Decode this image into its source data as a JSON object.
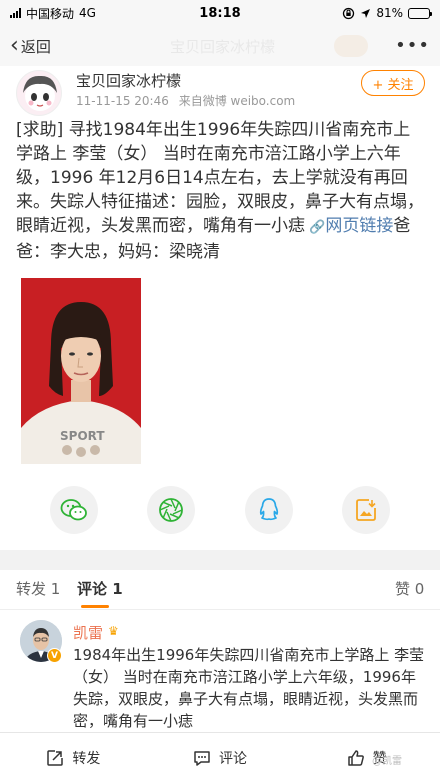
{
  "status_bar": {
    "carrier": "中国移动",
    "network": "4G",
    "time": "18:18",
    "battery": "81%",
    "battery_level": 0.81
  },
  "nav": {
    "back_label": "返回",
    "title": "宝贝回家冰柠檬"
  },
  "post": {
    "user_name": "宝贝回家冰柠檬",
    "time": "11-11-15 20:46",
    "source": "来自微博 weibo.com",
    "follow_label": "+ 关注",
    "text": "[求助] 寻找1984年出生1996年失踪四川省南充市上学路上 李莹（女） 当时在南充市涪江路小学上六年级，1996 年12月6日14点左右，去上学就没有再回来。失踪人特征描述：园脸，双眼皮，鼻子大有点塌，眼睛近视，头发黑而密，嘴角有一小痣",
    "link_text": "网页链接",
    "parents": "爸爸：李大忠，妈妈：梁晓清",
    "photo_shirt_text": "SPORT"
  },
  "tabs": {
    "repost": "转发 1",
    "comment": "评论 1",
    "like": "赞 0"
  },
  "comment": {
    "name": "凯雷",
    "text": "1984年出生1996年失踪四川省南充市上学路上 李莹（女） 当时在南充市涪江路小学上六年级，1996年失踪，双眼皮，鼻子大有点塌，眼睛近视，头发黑而密，嘴角有一小痣"
  },
  "bottom_bar": {
    "repost": "转发",
    "comment": "评论",
    "like": "赞"
  },
  "watermark": "@凯雷",
  "colors": {
    "accent": "#ff8200",
    "link": "#507daf",
    "commenter": "#eb7350"
  }
}
